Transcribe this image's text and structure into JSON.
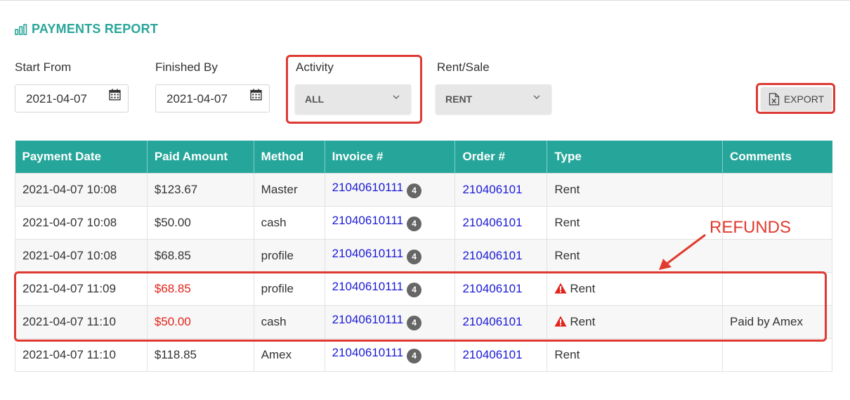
{
  "page": {
    "title": "PAYMENTS REPORT"
  },
  "filters": {
    "start_from": {
      "label": "Start From",
      "value": "2021-04-07"
    },
    "finished_by": {
      "label": "Finished By",
      "value": "2021-04-07"
    },
    "activity": {
      "label": "Activity",
      "selected": "ALL"
    },
    "rent_sale": {
      "label": "Rent/Sale",
      "selected": "RENT"
    }
  },
  "toolbar": {
    "export_label": "EXPORT"
  },
  "annotation": {
    "text": "REFUNDS",
    "color": "#e23a2e"
  },
  "colors": {
    "accent": "#26a69a",
    "link": "#1a1ad6",
    "refund": "#e2231a",
    "highlight": "#dd3a33"
  },
  "table": {
    "headers": [
      "Payment Date",
      "Paid Amount",
      "Method",
      "Invoice #",
      "Order #",
      "Type",
      "Comments"
    ],
    "rows": [
      {
        "date": "2021-04-07 10:08",
        "amount": "$123.67",
        "method": "Master",
        "invoice": "21040610111",
        "invoice_badge": "4",
        "order": "210406101",
        "type": "Rent",
        "comments": "",
        "refund": false
      },
      {
        "date": "2021-04-07 10:08",
        "amount": "$50.00",
        "method": "cash",
        "invoice": "21040610111",
        "invoice_badge": "4",
        "order": "210406101",
        "type": "Rent",
        "comments": "",
        "refund": false
      },
      {
        "date": "2021-04-07 10:08",
        "amount": "$68.85",
        "method": "profile",
        "invoice": "21040610111",
        "invoice_badge": "4",
        "order": "210406101",
        "type": "Rent",
        "comments": "",
        "refund": false
      },
      {
        "date": "2021-04-07 11:09",
        "amount": "$68.85",
        "method": "profile",
        "invoice": "21040610111",
        "invoice_badge": "4",
        "order": "210406101",
        "type": "Rent",
        "comments": "",
        "refund": true
      },
      {
        "date": "2021-04-07 11:10",
        "amount": "$50.00",
        "method": "cash",
        "invoice": "21040610111",
        "invoice_badge": "4",
        "order": "210406101",
        "type": "Rent",
        "comments": "Paid by Amex",
        "refund": true
      },
      {
        "date": "2021-04-07 11:10",
        "amount": "$118.85",
        "method": "Amex",
        "invoice": "21040610111",
        "invoice_badge": "4",
        "order": "210406101",
        "type": "Rent",
        "comments": "",
        "refund": false
      }
    ]
  }
}
